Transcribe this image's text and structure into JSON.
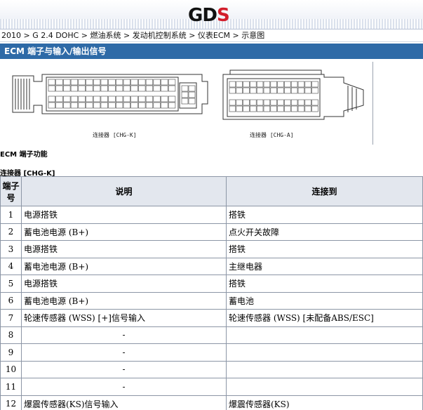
{
  "header": {
    "logo_g": "G",
    "logo_d": "D",
    "logo_s": "S"
  },
  "breadcrumb": "2010 > G 2.4 DOHC > 燃油系统 > 发动机控制系统 > 仪表ECM > 示意图",
  "section_title": "ECM 端子与输入/输出信号",
  "diagram": {
    "left_caption": "连接器 [CHG-K]",
    "right_caption": "连接器 [CHG-A]"
  },
  "function_title": "ECM 端子功能",
  "connector_title": "连接器 [CHG-K]",
  "table": {
    "headers": [
      "端子号",
      "说明",
      "连接到"
    ],
    "rows": [
      {
        "pin": "1",
        "desc": "电源搭铁",
        "to": "搭铁"
      },
      {
        "pin": "2",
        "desc": "蓄电池电源 (B+)",
        "to": "点火开关故障"
      },
      {
        "pin": "3",
        "desc": "电源搭铁",
        "to": "搭铁"
      },
      {
        "pin": "4",
        "desc": "蓄电池电源 (B+)",
        "to": "主继电器"
      },
      {
        "pin": "5",
        "desc": "电源搭铁",
        "to": "搭铁"
      },
      {
        "pin": "6",
        "desc": "蓄电池电源 (B+)",
        "to": "蓄电池"
      },
      {
        "pin": "7",
        "desc": "轮速传感器 (WSS) [+]信号输入",
        "to": "轮速传感器 (WSS) [未配备ABS/ESC]"
      },
      {
        "pin": "8",
        "desc": "-",
        "to": ""
      },
      {
        "pin": "9",
        "desc": "-",
        "to": ""
      },
      {
        "pin": "10",
        "desc": "-",
        "to": ""
      },
      {
        "pin": "11",
        "desc": "-",
        "to": ""
      },
      {
        "pin": "12",
        "desc": "爆震传感器(KS)信号输入",
        "to": "爆震传感器(KS)"
      }
    ]
  }
}
